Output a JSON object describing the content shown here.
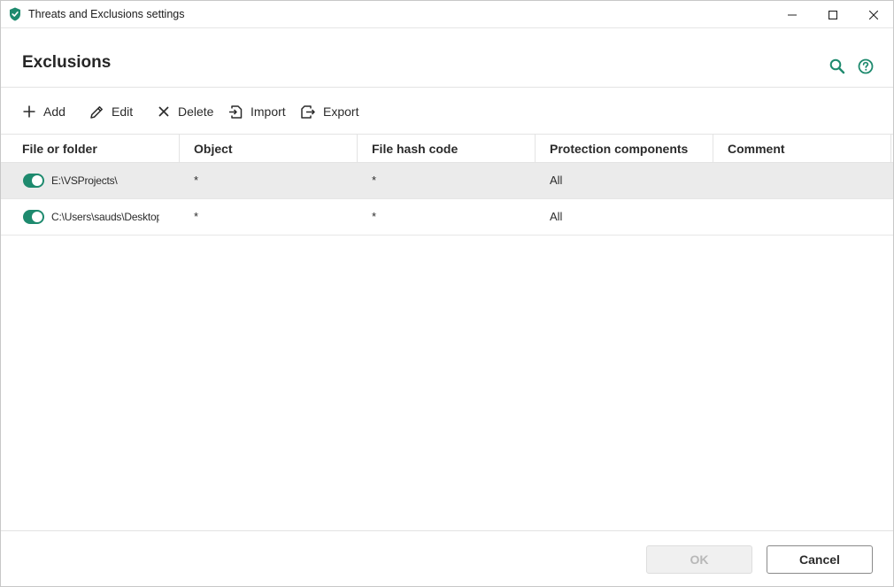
{
  "window": {
    "title": "Threats and Exclusions settings"
  },
  "header": {
    "title": "Exclusions",
    "search_icon": "search-icon",
    "help_icon": "help-icon"
  },
  "toolbar": {
    "add_label": "Add",
    "edit_label": "Edit",
    "delete_label": "Delete",
    "import_label": "Import",
    "export_label": "Export"
  },
  "table": {
    "columns": [
      "File or folder",
      "Object",
      "File hash code",
      "Protection components",
      "Comment"
    ],
    "rows": [
      {
        "enabled": true,
        "path": "E:\\VSProjects\\",
        "object": "*",
        "hash": "*",
        "components": "All",
        "comment": ""
      },
      {
        "enabled": true,
        "path": "C:\\Users\\sauds\\Desktop",
        "object": "*",
        "hash": "*",
        "components": "All",
        "comment": ""
      }
    ]
  },
  "footer": {
    "ok_label": "OK",
    "cancel_label": "Cancel"
  },
  "colors": {
    "accent": "#1e8a6e",
    "selected_row": "#ebebeb"
  }
}
